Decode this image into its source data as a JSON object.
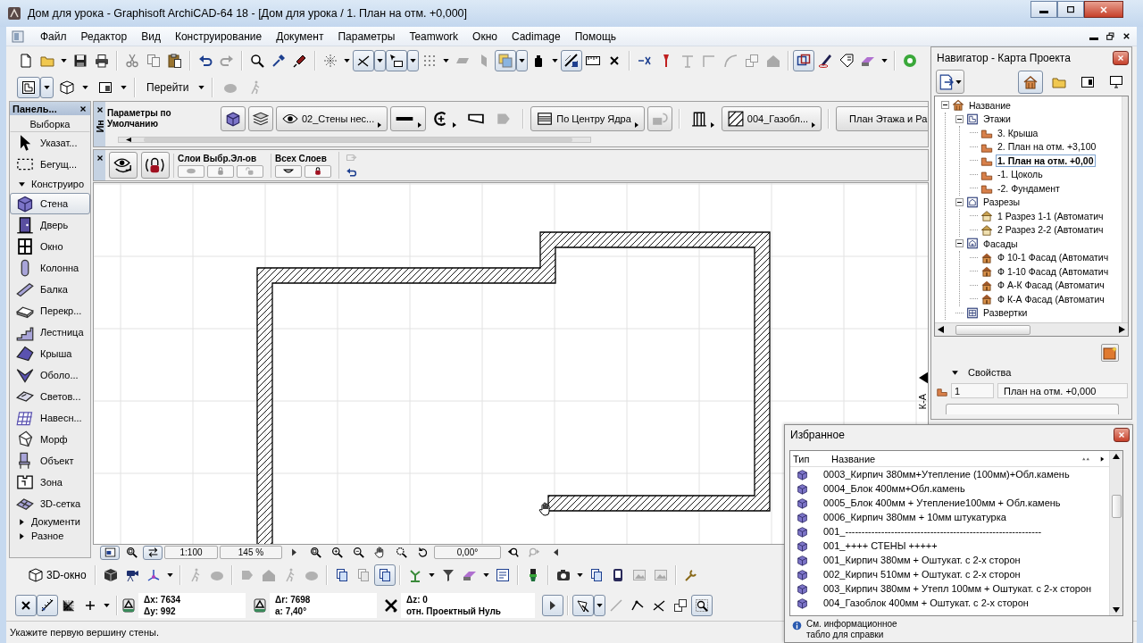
{
  "window": {
    "title": "Дом для урока - Graphisoft ArchiCAD-64 18 - [Дом для урока / 1. План на отм. +0,000]"
  },
  "menu_bar": [
    "Файл",
    "Редактор",
    "Вид",
    "Конструирование",
    "Документ",
    "Параметры",
    "Teamwork",
    "Окно",
    "Cadimage",
    "Помощь"
  ],
  "main_toolbar": [
    [
      {
        "kind": "page",
        "pressed": false,
        "disabled": false
      },
      {
        "kind": "folder",
        "pressed": false,
        "disabled": false
      },
      {
        "kind": "dropdown",
        "pressed": false,
        "disabled": false
      },
      {
        "kind": "floppy",
        "pressed": false,
        "disabled": false
      },
      {
        "kind": "printer",
        "pressed": false,
        "disabled": false
      }
    ],
    [
      {
        "kind": "scissors",
        "pressed": false,
        "disabled": true
      },
      {
        "kind": "copy",
        "pressed": false,
        "disabled": true
      },
      {
        "kind": "clipboard",
        "pressed": false,
        "disabled": false
      }
    ],
    [
      {
        "kind": "undo",
        "pressed": false,
        "disabled": false
      },
      {
        "kind": "redo",
        "pressed": false,
        "disabled": true
      }
    ],
    [
      {
        "kind": "magnifier",
        "pressed": false,
        "disabled": false
      },
      {
        "kind": "dropper",
        "pressed": false,
        "disabled": false
      },
      {
        "kind": "syringe",
        "pressed": false,
        "disabled": false
      }
    ],
    [
      {
        "kind": "sparkle",
        "pressed": false,
        "disabled": false
      },
      {
        "kind": "dropdown",
        "pressed": false,
        "disabled": false
      },
      {
        "kind": "angle",
        "pressed": true,
        "disabled": false
      },
      {
        "kind": "dropdown",
        "pressed": true,
        "disabled": false
      },
      {
        "kind": "cursorbox",
        "pressed": true,
        "disabled": false
      },
      {
        "kind": "dropdown",
        "pressed": true,
        "disabled": false
      },
      {
        "kind": "dots",
        "pressed": false,
        "disabled": false
      },
      {
        "kind": "dropdown",
        "pressed": false,
        "disabled": false
      },
      {
        "kind": "parallelogram",
        "pressed": false,
        "disabled": true
      },
      {
        "kind": "slab",
        "pressed": false,
        "disabled": true
      },
      {
        "kind": "squares",
        "pressed": true,
        "disabled": false
      },
      {
        "kind": "dropdown",
        "pressed": true,
        "disabled": false
      },
      {
        "kind": "bottle",
        "pressed": false,
        "disabled": false
      },
      {
        "kind": "dropdown",
        "pressed": false,
        "disabled": false
      },
      {
        "kind": "hatch",
        "pressed": true,
        "disabled": false
      },
      {
        "kind": "ruler",
        "pressed": false,
        "disabled": false
      },
      {
        "kind": "cross",
        "pressed": false,
        "disabled": false
      }
    ],
    [
      {
        "kind": "split",
        "pressed": false,
        "disabled": false
      },
      {
        "kind": "pin",
        "pressed": false,
        "disabled": false
      },
      {
        "kind": "tee",
        "pressed": false,
        "disabled": true
      },
      {
        "kind": "corner",
        "pressed": false,
        "disabled": true
      },
      {
        "kind": "arc",
        "pressed": false,
        "disabled": true
      },
      {
        "kind": "boxes",
        "pressed": false,
        "disabled": true
      },
      {
        "kind": "house",
        "pressed": false,
        "disabled": true
      }
    ],
    [
      {
        "kind": "frame",
        "pressed": true,
        "disabled": false
      },
      {
        "kind": "pen",
        "pressed": false,
        "disabled": false
      },
      {
        "kind": "tag",
        "pressed": false,
        "disabled": false
      },
      {
        "kind": "eraser",
        "pressed": false,
        "disabled": false
      },
      {
        "kind": "dropdown",
        "pressed": false,
        "disabled": false
      }
    ],
    [
      {
        "kind": "globe",
        "pressed": false,
        "disabled": false
      }
    ]
  ],
  "view_toolbar": [
    [
      {
        "kind": "plan",
        "pressed": true,
        "disabled": false
      },
      {
        "kind": "dropdown",
        "pressed": true,
        "disabled": false
      },
      {
        "kind": "cube",
        "pressed": false,
        "disabled": false
      },
      {
        "kind": "dropdown",
        "pressed": false,
        "disabled": false
      },
      {
        "kind": "panel",
        "pressed": false,
        "disabled": false
      },
      {
        "kind": "dropdown",
        "pressed": false,
        "disabled": false
      }
    ],
    [
      {
        "kind": "goto",
        "label": "Перейти",
        "pressed": false,
        "disabled": false
      },
      {
        "kind": "dropdown",
        "pressed": false,
        "disabled": false
      }
    ],
    [
      {
        "kind": "blob",
        "pressed": false,
        "disabled": true
      },
      {
        "kind": "walker",
        "pressed": false,
        "disabled": true
      }
    ]
  ],
  "toolbox": {
    "title": "Панель...",
    "selection": "Выборка",
    "tools": [
      {
        "kind": "pointer",
        "label": "Указат...",
        "selected": false
      },
      {
        "kind": "marquee",
        "label": "Бегущ...",
        "selected": false
      }
    ],
    "groups": [
      {
        "label": "Конструиро",
        "expanded": true,
        "tools": [
          {
            "kind": "wall",
            "label": "Стена",
            "selected": true
          },
          {
            "kind": "door",
            "label": "Дверь",
            "selected": false
          },
          {
            "kind": "window",
            "label": "Окно",
            "selected": false
          },
          {
            "kind": "column",
            "label": "Колонна",
            "selected": false
          },
          {
            "kind": "beam",
            "label": "Балка",
            "selected": false
          },
          {
            "kind": "plate",
            "label": "Перекр...",
            "selected": false
          },
          {
            "kind": "stair",
            "label": "Лестница",
            "selected": false
          },
          {
            "kind": "roof",
            "label": "Крыша",
            "selected": false
          },
          {
            "kind": "shell",
            "label": "Оболо...",
            "selected": false
          },
          {
            "kind": "skylight",
            "label": "Светов...",
            "selected": false
          },
          {
            "kind": "curtainwall",
            "label": "Навесн...",
            "selected": false
          },
          {
            "kind": "morph",
            "label": "Морф",
            "selected": false
          },
          {
            "kind": "object",
            "label": "Объект",
            "selected": false
          },
          {
            "kind": "zone",
            "label": "Зона",
            "selected": false
          },
          {
            "kind": "mesh",
            "label": "3D-сетка",
            "selected": false
          }
        ]
      },
      {
        "label": "Документи",
        "expanded": false
      },
      {
        "label": "Разное",
        "expanded": false
      }
    ]
  },
  "info_box": {
    "tab": "Ин",
    "title": "Параметры по Умолчанию",
    "controls": [
      [
        {
          "kind": "wall",
          "disabled": false
        },
        {
          "kind": "layers",
          "disabled": false
        },
        {
          "kind": "layer",
          "label": "02_Стены нес...",
          "disabled": false
        },
        {
          "kind": "line",
          "disabled": false
        },
        {
          "kind": "cplus",
          "disabled": false
        },
        {
          "kind": "wedge",
          "disabled": false
        },
        {
          "kind": "flag",
          "disabled": true
        }
      ],
      [
        {
          "kind": "reference",
          "label": "По Центру Ядра",
          "disabled": false
        },
        {
          "kind": "flip",
          "disabled": true
        }
      ],
      [
        {
          "kind": "pillar",
          "disabled": false
        },
        {
          "kind": "fill",
          "label": "004_Газобл...",
          "disabled": false
        }
      ],
      [
        {
          "kind": "view",
          "label": "План Этажа и Ра",
          "disabled": false
        }
      ]
    ]
  },
  "layer_bar": {
    "buttons": [
      {
        "kind": "eyecycle",
        "disabled": false
      },
      {
        "kind": "lockcycle",
        "disabled": false
      }
    ],
    "groups": [
      {
        "label": "Слои Выбр.Эл-ов",
        "buttons": [
          {
            "kind": "pill",
            "disabled": true
          },
          {
            "kind": "lock",
            "disabled": true
          },
          {
            "kind": "unlock",
            "disabled": true
          }
        ]
      },
      {
        "label": "Всех Слоев",
        "buttons": [
          {
            "kind": "smile",
            "disabled": false
          },
          {
            "kind": "lock",
            "disabled": false
          }
        ]
      }
    ],
    "extra": [
      {
        "kind": "copyframe",
        "disabled": true
      },
      {
        "kind": "undo",
        "disabled": false
      }
    ]
  },
  "plan_canvas": {
    "marker_label": "К-А"
  },
  "plan_footer": {
    "left": [
      [
        {
          "kind": "minimap",
          "pressed": true,
          "disabled": false
        },
        {
          "kind": "zoomfit",
          "pressed": false,
          "disabled": false
        },
        {
          "kind": "swap",
          "pressed": true,
          "disabled": false
        }
      ]
    ],
    "scale": "1:100",
    "zoom": "145 %",
    "middle": [
      [
        {
          "kind": "arrowright",
          "pressed": false,
          "disabled": false
        },
        {
          "kind": "zoomfit",
          "pressed": false,
          "disabled": false
        },
        {
          "kind": "zoomin",
          "pressed": false,
          "disabled": false
        },
        {
          "kind": "zoomout",
          "pressed": false,
          "disabled": false
        },
        {
          "kind": "hand",
          "pressed": false,
          "disabled": false
        },
        {
          "kind": "zoomall",
          "pressed": false,
          "disabled": false
        },
        {
          "kind": "rotate",
          "pressed": false,
          "disabled": false
        }
      ]
    ],
    "angle": "0,00°",
    "right": [
      [
        {
          "kind": "zoomback",
          "pressed": false,
          "disabled": false
        },
        {
          "kind": "zoomforward",
          "pressed": false,
          "disabled": true
        },
        {
          "kind": "arrowleft",
          "pressed": false,
          "disabled": false
        }
      ]
    ]
  },
  "view_3d_toolbar": {
    "label": "3D-окно",
    "groups": [
      [
        {
          "kind": "box",
          "pressed": false,
          "disabled": false
        },
        {
          "kind": "camera3d",
          "pressed": false,
          "disabled": false
        },
        {
          "kind": "axes",
          "pressed": false,
          "disabled": false
        },
        {
          "kind": "dropdown",
          "pressed": false,
          "disabled": false
        }
      ],
      [
        {
          "kind": "walker",
          "pressed": false,
          "disabled": true
        },
        {
          "kind": "blob",
          "pressed": false,
          "disabled": true
        }
      ],
      [
        {
          "kind": "flag",
          "pressed": false,
          "disabled": true
        },
        {
          "kind": "house",
          "pressed": false,
          "disabled": true
        },
        {
          "kind": "walker",
          "pressed": false,
          "disabled": true
        },
        {
          "kind": "blob",
          "pressed": false,
          "disabled": true
        }
      ],
      [
        {
          "kind": "docs",
          "pressed": false,
          "disabled": false
        },
        {
          "kind": "docs",
          "pressed": false,
          "disabled": true
        },
        {
          "kind": "docs",
          "pressed": true,
          "disabled": false
        }
      ],
      [
        {
          "kind": "plant",
          "pressed": false,
          "disabled": false
        },
        {
          "kind": "dropdown",
          "pressed": false,
          "disabled": false
        },
        {
          "kind": "funnel",
          "pressed": false,
          "disabled": false
        },
        {
          "kind": "eraser",
          "pressed": false,
          "disabled": false
        },
        {
          "kind": "dropdown",
          "pressed": false,
          "disabled": false
        },
        {
          "kind": "doc3d",
          "pressed": false,
          "disabled": false
        }
      ],
      [
        {
          "kind": "brush",
          "pressed": false,
          "disabled": false
        }
      ],
      [
        {
          "kind": "camera",
          "pressed": false,
          "disabled": false
        },
        {
          "kind": "dropdown",
          "pressed": false,
          "disabled": false
        },
        {
          "kind": "docs",
          "pressed": false,
          "disabled": false
        },
        {
          "kind": "tablet",
          "pressed": false,
          "disabled": false
        },
        {
          "kind": "picture",
          "pressed": false,
          "disabled": true
        },
        {
          "kind": "picture",
          "pressed": false,
          "disabled": true
        }
      ],
      [
        {
          "kind": "wrench",
          "pressed": false,
          "disabled": false
        }
      ]
    ]
  },
  "coordinates": {
    "tools": [
      [
        {
          "kind": "cross",
          "pressed": true,
          "disabled": false
        },
        {
          "kind": "measure",
          "pressed": true,
          "disabled": false
        },
        {
          "kind": "gridaxes",
          "pressed": false,
          "disabled": false
        },
        {
          "kind": "plus",
          "pressed": false,
          "disabled": false
        },
        {
          "kind": "dropdown",
          "pressed": false,
          "disabled": false
        }
      ]
    ],
    "fields": [
      {
        "kind": "delta",
        "lines": [
          "Δx: 7634",
          "Δy: 992"
        ]
      },
      {
        "kind": "delta",
        "lines": [
          "Δr: 7698",
          "a: 7,40°"
        ]
      },
      {
        "kind": "crossed",
        "lines": [
          "Δz: 0",
          "отн. Проектный Нуль"
        ]
      }
    ],
    "snap": [
      [
        {
          "kind": "arrowright",
          "pressed": true,
          "disabled": false
        }
      ],
      [
        {
          "kind": "wand",
          "pressed": true,
          "disabled": false
        },
        {
          "kind": "dropdown",
          "pressed": true,
          "disabled": false
        },
        {
          "kind": "diagonal",
          "pressed": false,
          "disabled": true
        },
        {
          "kind": "polyline",
          "pressed": false,
          "disabled": false
        },
        {
          "kind": "angle",
          "pressed": false,
          "disabled": false
        },
        {
          "kind": "boxes",
          "pressed": false,
          "disabled": false
        },
        {
          "kind": "zoomgrid",
          "pressed": true,
          "disabled": false
        }
      ]
    ]
  },
  "status_bar": {
    "text": "Укажите первую вершину стены."
  },
  "navigator": {
    "title": "Навигатор - Карта Проекта",
    "tabs": [
      {
        "kind": "project",
        "selected": true
      },
      {
        "kind": "folder",
        "selected": false
      },
      {
        "kind": "sheet",
        "selected": false
      },
      {
        "kind": "monitor",
        "selected": false
      }
    ],
    "tree": [
      {
        "label": "Название",
        "kind": "project",
        "expanded": true,
        "selected": false,
        "children": [
          {
            "label": "Этажи",
            "kind": "stories",
            "expanded": true,
            "selected": false,
            "children": [
              {
                "label": "3. Крыша",
                "kind": "story",
                "selected": false
              },
              {
                "label": "2. План на отм. +3,100",
                "kind": "story",
                "selected": false
              },
              {
                "label": "1. План на отм. +0,00",
                "kind": "story",
                "selected": true
              },
              {
                "label": "-1. Цоколь",
                "kind": "story",
                "selected": false
              },
              {
                "label": "-2. Фундамент",
                "kind": "story",
                "selected": false
              }
            ]
          },
          {
            "label": "Разрезы",
            "kind": "sections",
            "expanded": true,
            "selected": false,
            "children": [
              {
                "label": "1 Разрез 1-1 (Автоматич",
                "kind": "section",
                "selected": false
              },
              {
                "label": "2 Разрез 2-2 (Автоматич",
                "kind": "section",
                "selected": false
              }
            ]
          },
          {
            "label": "Фасады",
            "kind": "elevations",
            "expanded": true,
            "selected": false,
            "children": [
              {
                "label": "Ф 10-1 Фасад (Автоматич",
                "kind": "elevation",
                "selected": false
              },
              {
                "label": "Ф 1-10 Фасад (Автоматич",
                "kind": "elevation",
                "selected": false
              },
              {
                "label": "Ф А-К Фасад (Автоматич",
                "kind": "elevation",
                "selected": false
              },
              {
                "label": "Ф К-А Фасад (Автоматич",
                "kind": "elevation",
                "selected": false
              }
            ]
          },
          {
            "label": "Развертки",
            "kind": "worksheets",
            "selected": false
          }
        ]
      }
    ],
    "properties": {
      "label": "Свойства",
      "expanded": true,
      "number": "1",
      "name": "План на отм. +0,000"
    }
  },
  "favorites": {
    "title": "Избранное",
    "columns": [
      "Тип",
      "Название"
    ],
    "items": [
      {
        "label": "0003_Кирпич 380мм+Утепление (100мм)+Обл.камень",
        "selected": false
      },
      {
        "label": "0004_Блок 400мм+Обл.камень",
        "selected": false
      },
      {
        "label": "0005_Блок 400мм + Утепление100мм + Обл.камень",
        "selected": false
      },
      {
        "label": "0006_Кирпич 380мм + 10мм штукатурка",
        "selected": false
      },
      {
        "label": "001_------------------------------------------------------------",
        "selected": false
      },
      {
        "label": "001_++++ СТЕНЫ +++++",
        "selected": false
      },
      {
        "label": "001_Кирпич 380мм + Оштукат. с 2-х сторон",
        "selected": false
      },
      {
        "label": "002_Кирпич 510мм + Оштукат. с 2-х сторон",
        "selected": false
      },
      {
        "label": "003_Кирпич 380мм + Утепл 100мм + Оштукат. с 2-х сторон",
        "selected": false
      },
      {
        "label": "004_Газоблок 400мм + Оштукат. с 2-х сторон",
        "selected": false
      }
    ],
    "hint": "См. информационное табло для справки"
  }
}
